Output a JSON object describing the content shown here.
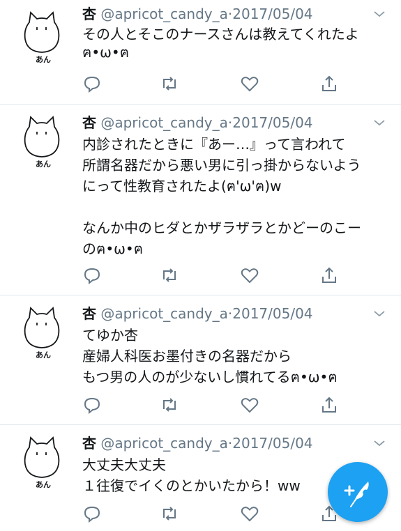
{
  "tweets": [
    {
      "display_name": "杏",
      "handle": "@apricot_candy_a",
      "separator": "·",
      "date": "2017/05/04",
      "avatar_caption": "あん",
      "text": "その人とそこのナースさんは教えてくれたよ\nฅ•ω•ฅ"
    },
    {
      "display_name": "杏",
      "handle": "@apricot_candy_a",
      "separator": "·",
      "date": "2017/05/04",
      "avatar_caption": "あん",
      "text": "内診されたときに『あー…』って言われて\n所謂名器だから悪い男に引っ掛からないよう\nにって性教育されたよ(ฅ'ω'ฅ)w\n\nなんか中のヒダとかザラザラとかどーのこー\nのฅ•ω•ฅ"
    },
    {
      "display_name": "杏",
      "handle": "@apricot_candy_a",
      "separator": "·",
      "date": "2017/05/04",
      "avatar_caption": "あん",
      "text": "てゆか杏\n産婦人科医お墨付きの名器だから\nもつ男の人のが少ないし慣れてるฅ•ω•ฅ"
    },
    {
      "display_name": "杏",
      "handle": "@apricot_candy_a",
      "separator": "·",
      "date": "2017/05/04",
      "avatar_caption": "あん",
      "text": "大丈夫大丈夫\n１往復でイくのとかいたから！ww"
    }
  ],
  "icons": {
    "reply": "reply-icon",
    "retweet": "retweet-icon",
    "like": "heart-icon",
    "share": "share-icon",
    "more": "chevron-down-icon",
    "compose": "compose-tweet-icon"
  },
  "colors": {
    "icon_gray": "#657786",
    "accent": "#1da1f2",
    "divider": "#e1e8ed"
  }
}
